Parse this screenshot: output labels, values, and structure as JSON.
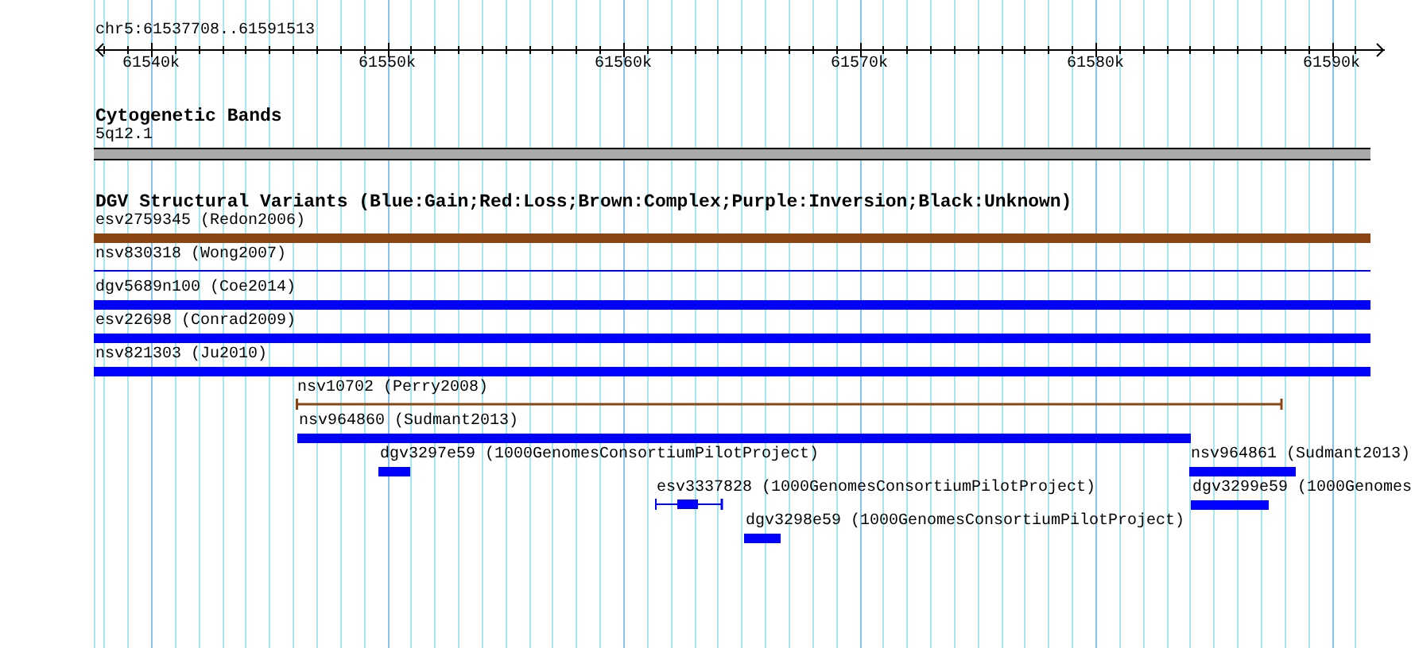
{
  "ruler": {
    "title": "chr5:61537708..61591513",
    "ticks": [
      "61540k",
      "61550k",
      "61560k",
      "61570k",
      "61580k",
      "61590k"
    ]
  },
  "cytoband_track": {
    "title": "Cytogenetic Bands",
    "band_label": "5q12.1"
  },
  "variant_track": {
    "title": "DGV Structural Variants (Blue:Gain;Red:Loss;Brown:Complex;Purple:Inversion;Black:Unknown)",
    "features": [
      {
        "label": "esv2759345 (Redon2006)",
        "kind": "bar",
        "color": "#8b4513"
      },
      {
        "label": "nsv830318 (Wong2007)",
        "kind": "line",
        "color": "#0000ff"
      },
      {
        "label": "dgv5689n100 (Coe2014)",
        "kind": "bar",
        "color": "#0000ff"
      },
      {
        "label": "esv22698 (Conrad2009)",
        "kind": "bar",
        "color": "#0000ff"
      },
      {
        "label": "nsv821303 (Ju2010)",
        "kind": "bar",
        "color": "#0000ff"
      },
      {
        "label": "nsv10702 (Perry2008)",
        "kind": "span",
        "color": "#8b4513"
      },
      {
        "label": "nsv964860 (Sudmant2013)",
        "kind": "bar",
        "color": "#0000ff"
      },
      {
        "label": "dgv3297e59 (1000GenomesConsortiumPilotProject)",
        "kind": "bar",
        "color": "#0000ff"
      },
      {
        "label": "nsv964861 (Sudmant2013)",
        "kind": "bar",
        "color": "#0000ff"
      },
      {
        "label": "esv3337828 (1000GenomesConsortiumPilotProject)",
        "kind": "gapped",
        "color": "#0000ff"
      },
      {
        "label": "dgv3299e59 (1000Genomes",
        "kind": "bar",
        "color": "#0000ff"
      },
      {
        "label": "dgv3298e59 (1000GenomesConsortiumPilotProject)",
        "kind": "bar",
        "color": "#0000ff"
      }
    ]
  }
}
